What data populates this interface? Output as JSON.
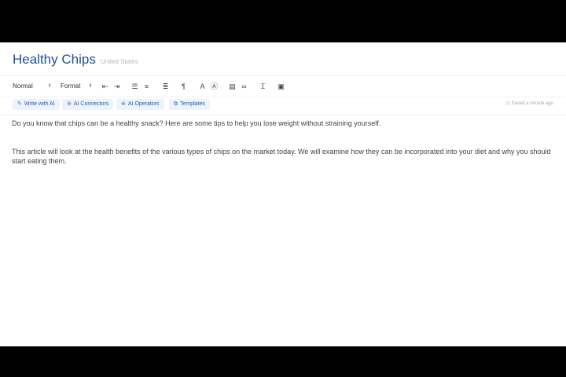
{
  "header": {
    "title": "Healthy Chips",
    "subtitle": "United States"
  },
  "toolbar": {
    "style_select": "Normal",
    "format_select": "Format",
    "icons": [
      "outdent-icon",
      "indent-icon",
      "ordered-list-icon",
      "bullet-list-icon",
      "align-icon",
      "paragraph-direction-icon",
      "font-color-icon",
      "background-color-icon",
      "video-icon",
      "link-icon",
      "clear-format-icon",
      "image-icon"
    ]
  },
  "actions": {
    "write_ai": "Write with AI",
    "connectors": "AI Connectors",
    "operators": "AI Operators",
    "templates": "Templates",
    "right_link": "Saved a minute ago"
  },
  "content": {
    "p1": "Do you know that chips can be a healthy snack? Here are some tips to help you lose weight without straining yourself.",
    "p2": "This article will look at the health benefits of the various types of chips on the market today. We will examine how they can be incorporated into your diet and why you should start eating them."
  },
  "colors": {
    "title": "#1f4f96",
    "accent": "#1f5cb8",
    "chip_bg": "#eef3fb"
  }
}
